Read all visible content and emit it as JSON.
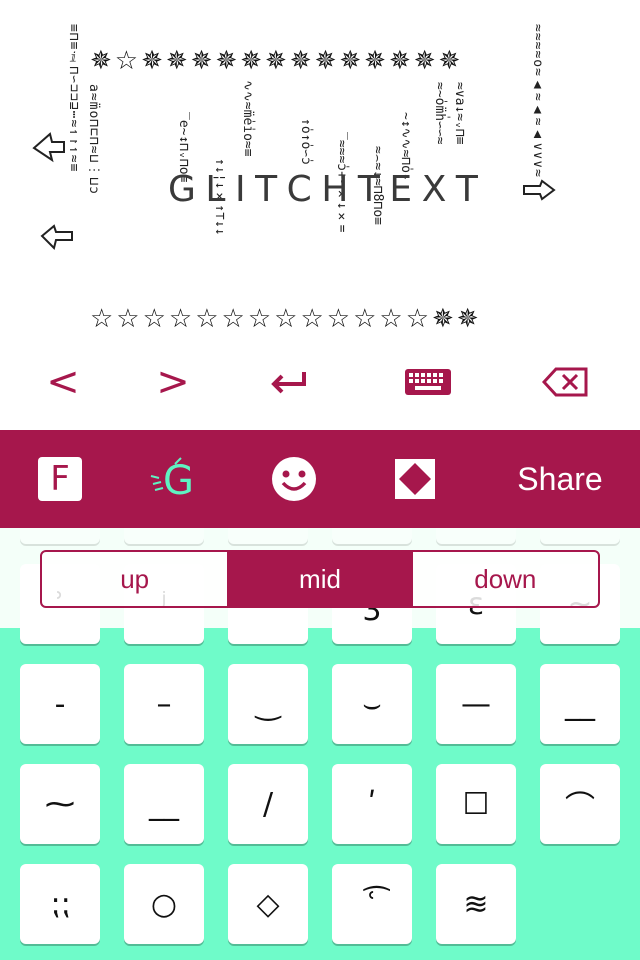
{
  "preview": {
    "top_stars": "✵☆✵✵✵✵✵✵✵✵✵✵✵✵✵",
    "bottom_stars": "☆☆☆☆☆☆☆☆☆☆☆☆☆✵✵",
    "glitch_text": [
      "G",
      "L",
      "I",
      "T",
      "C",
      "H",
      "T",
      "E",
      "X",
      "T"
    ],
    "left_column": "≡⊓≡ⅈ⊓∽⊐⊐⊒⋯≈↿↾↿≈≡",
    "left_column_2": "a≈m̈o⊓⊏⊓≈⊔⋮⊔ɔ",
    "right_column": "≈≈≈≈o≈▲≈▲≈▲∨∨∨≈",
    "glitch_marks": [
      "‾e~↕⊓ᵥ⊓o≡",
      "↑↓¦↓×↑⊤↓↓",
      "∿∿≈m̈e̍i̍o≈≡",
      "↑o̍↑o̍∽ɔ̍",
      "‾≈≈≈ɔ̍+∽×↓×=",
      "≈⌢≈↓≈⊓8⊓o≡",
      "~↕∿∿≈⊓o̍ᵥ",
      "≈~o̍m̈h̍∽∽≈",
      "≈∨a↓≈ᵥ⊓≡"
    ]
  },
  "controls": {
    "prev": "<",
    "next": ">",
    "return": "↩",
    "keyboard": "⌨",
    "delete": "⌫"
  },
  "toolbar": {
    "font_button": "F",
    "share_label": "Share"
  },
  "position_selector": {
    "options": [
      "up",
      "mid",
      "down"
    ],
    "selected": "mid"
  },
  "keys": {
    "ghost_row": [
      "ʾ",
      "ʲ",
      "ʿ",
      "ʒ",
      "ɛ",
      "~"
    ],
    "row1": [
      "-",
      "–",
      "‿",
      "⌣",
      "—",
      "__"
    ],
    "row2": [
      "⁓",
      "__",
      "/",
      "ʹ",
      "☐",
      "⌒"
    ],
    "row3": [
      "⁏⁏",
      "○",
      "◇",
      "ʿ͡",
      "≋"
    ]
  },
  "colors": {
    "accent": "#a6174c",
    "keyboard_bg": "#6ffbc9",
    "toolbar_icon_accent": "#5ff3c2"
  }
}
